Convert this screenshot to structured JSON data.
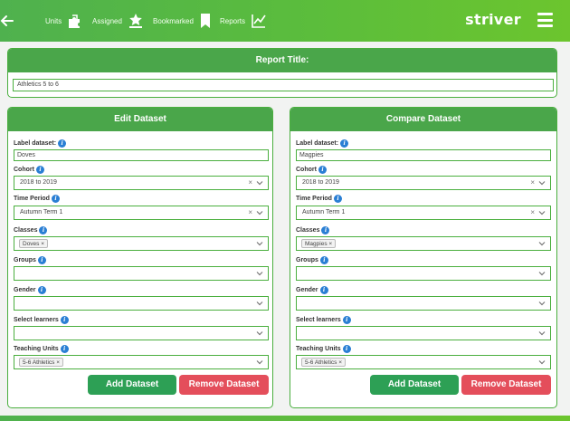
{
  "colors": {
    "brand_green": "#4fb14e",
    "header_green": "#4aa64a",
    "add_green": "#2da055",
    "remove_red": "#e44e5b",
    "info_blue": "#2a7fd4"
  },
  "nav": {
    "back_icon": "arrow-left-icon",
    "items": [
      {
        "label": "Units",
        "icon": "puzzle-icon"
      },
      {
        "label": "Assigned",
        "icon": "star-hand-icon"
      },
      {
        "label": "Bookmarked",
        "icon": "bookmark-icon"
      },
      {
        "label": "Reports",
        "icon": "line-chart-icon"
      }
    ],
    "brand": "striver",
    "menu_icon": "hamburger-icon"
  },
  "report": {
    "heading": "Report Title:",
    "title_value": "Athletics 5 to 6"
  },
  "edit": {
    "heading": "Edit Dataset",
    "label_dataset": {
      "label": "Label dataset:",
      "value": "Doves"
    },
    "cohort": {
      "label": "Cohort",
      "value": "2018 to 2019"
    },
    "time_period": {
      "label": "Time Period",
      "value": "Autumn Term 1"
    },
    "classes": {
      "label": "Classes",
      "tag": "Doves"
    },
    "groups": {
      "label": "Groups"
    },
    "gender": {
      "label": "Gender"
    },
    "learners": {
      "label": "Select learners"
    },
    "units": {
      "label": "Teaching Units",
      "tag": "5-6 Athletics"
    },
    "add_button": "Add Dataset",
    "remove_button": "Remove Dataset"
  },
  "compare": {
    "heading": "Compare Dataset",
    "label_dataset": {
      "label": "Label dataset:",
      "value": "Magpies"
    },
    "cohort": {
      "label": "Cohort",
      "value": "2018 to 2019"
    },
    "time_period": {
      "label": "Time Period",
      "value": "Autumn Term 1"
    },
    "classes": {
      "label": "Classes",
      "tag": "Magpies"
    },
    "groups": {
      "label": "Groups"
    },
    "gender": {
      "label": "Gender"
    },
    "learners": {
      "label": "Select learners"
    },
    "units": {
      "label": "Teaching Units",
      "tag": "5-6 Athletics"
    },
    "add_button": "Add Dataset",
    "remove_button": "Remove Dataset"
  },
  "glyphs": {
    "info": "i",
    "clear": "×",
    "tag_remove": "×"
  }
}
